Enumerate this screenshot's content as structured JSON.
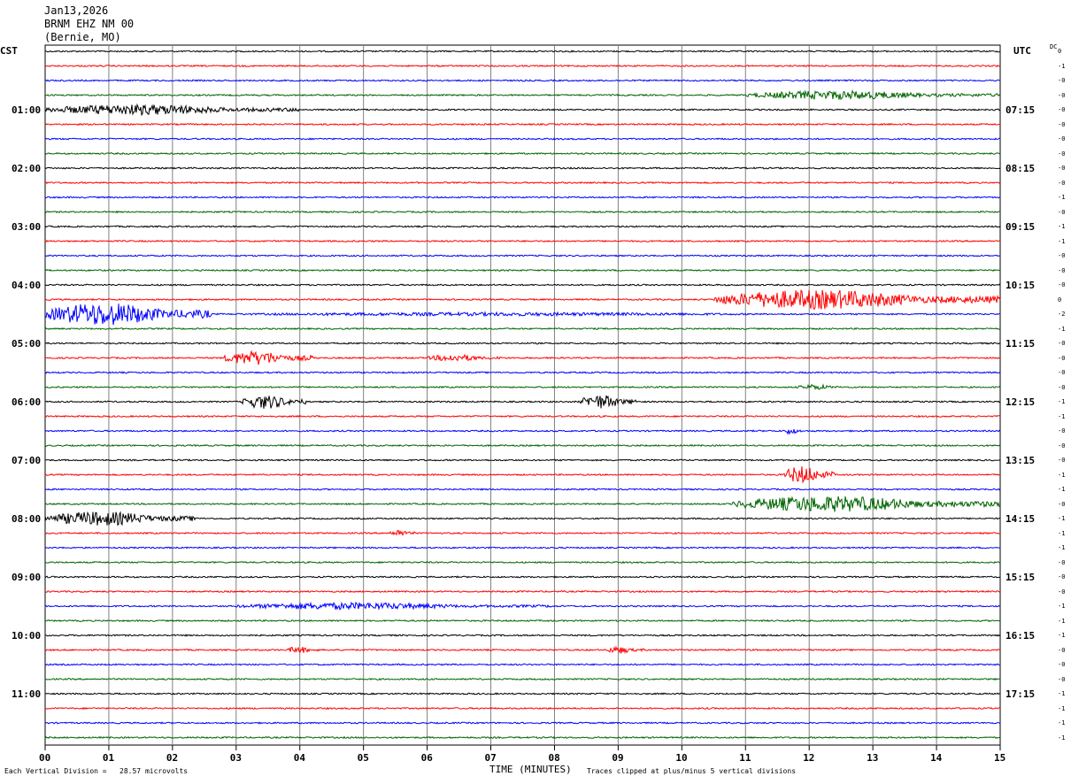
{
  "header": {
    "date": "Jan13,2026",
    "station": "BRNM EHZ NM 00",
    "location": "(Bernie, MO)"
  },
  "left_zone": "CST",
  "right_zone": "UTC",
  "dc_label": "DC",
  "chart_data": {
    "type": "line",
    "title": "",
    "xlabel": "TIME (MINUTES)",
    "xlim": [
      0,
      15
    ],
    "x_ticks": [
      "00",
      "01",
      "02",
      "03",
      "04",
      "05",
      "06",
      "07",
      "08",
      "09",
      "10",
      "11",
      "12",
      "13",
      "14",
      "15"
    ],
    "row_minutes": 15,
    "row_count": 48,
    "trace_colors": [
      "#000000",
      "#ff0000",
      "#0000ff",
      "#006400"
    ],
    "left_hour_labels": [
      "01:00",
      "02:00",
      "03:00",
      "04:00",
      "05:00",
      "06:00",
      "07:00",
      "08:00",
      "09:00",
      "10:00",
      "11:00"
    ],
    "left_label_rows": [
      4,
      8,
      12,
      16,
      20,
      24,
      28,
      32,
      36,
      40,
      44
    ],
    "right_hour_labels": [
      "07:15",
      "08:15",
      "09:15",
      "10:15",
      "11:15",
      "12:15",
      "13:15",
      "14:15",
      "15:15",
      "16:15",
      "17:15"
    ],
    "right_label_rows": [
      4,
      8,
      12,
      16,
      20,
      24,
      28,
      32,
      36,
      40,
      44
    ],
    "dc_offsets": [
      "0",
      "-1",
      "-0",
      "-0",
      "-0",
      "-0",
      "-0",
      "-0",
      "-0",
      "-0",
      "-1",
      "-0",
      "-1",
      "-1",
      "-0",
      "-0",
      "-0",
      "0",
      "-2",
      "-1",
      "-0",
      "-0",
      "-0",
      "-0",
      "-1",
      "-1",
      "-0",
      "-0",
      "-0",
      "-1",
      "-1",
      "-0",
      "-1",
      "-1",
      "-1",
      "-0",
      "-0",
      "-0",
      "-1",
      "-1",
      "-1",
      "-0",
      "-0",
      "-0",
      "-1",
      "-1",
      "-1",
      "-1"
    ],
    "events": [
      {
        "row": 3,
        "start": 11,
        "end": 15,
        "amp": 5
      },
      {
        "row": 4,
        "start": 0,
        "end": 4,
        "amp": 6
      },
      {
        "row": 17,
        "start": 10.5,
        "end": 15,
        "amp": 11
      },
      {
        "row": 18,
        "start": 0,
        "end": 2.6,
        "amp": 13
      },
      {
        "row": 18,
        "start": 2.6,
        "end": 15,
        "amp": 2
      },
      {
        "row": 21,
        "start": 2.8,
        "end": 4.2,
        "amp": 8
      },
      {
        "row": 21,
        "start": 6,
        "end": 7.2,
        "amp": 4
      },
      {
        "row": 23,
        "start": 11.8,
        "end": 12.6,
        "amp": 3
      },
      {
        "row": 24,
        "start": 3.1,
        "end": 4.1,
        "amp": 8
      },
      {
        "row": 24,
        "start": 8.4,
        "end": 9.3,
        "amp": 8
      },
      {
        "row": 26,
        "start": 11.6,
        "end": 11.9,
        "amp": 4
      },
      {
        "row": 29,
        "start": 11.6,
        "end": 12.4,
        "amp": 10
      },
      {
        "row": 31,
        "start": 10.8,
        "end": 15,
        "amp": 9
      },
      {
        "row": 32,
        "start": 0,
        "end": 2.4,
        "amp": 8
      },
      {
        "row": 33,
        "start": 5.4,
        "end": 5.8,
        "amp": 4
      },
      {
        "row": 38,
        "start": 3,
        "end": 8,
        "amp": 4
      },
      {
        "row": 41,
        "start": 3.8,
        "end": 4.3,
        "amp": 4
      },
      {
        "row": 41,
        "start": 8.8,
        "end": 9.4,
        "amp": 4
      }
    ]
  },
  "footer": {
    "left": "Each Vertical Division =   28.57 microvolts",
    "right": "Traces clipped at plus/minus 5 vertical divisions"
  }
}
